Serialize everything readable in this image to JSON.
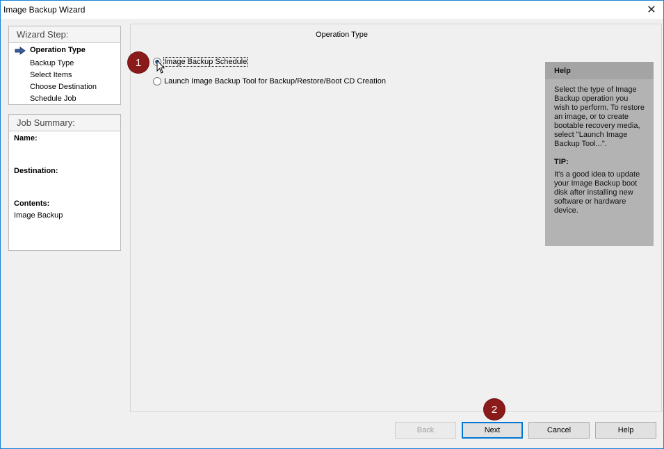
{
  "window": {
    "title": "Image Backup Wizard"
  },
  "wizard_steps": {
    "header": "Wizard Step:",
    "items": [
      {
        "label": "Operation Type",
        "active": true
      },
      {
        "label": "Backup Type",
        "active": false
      },
      {
        "label": "Select Items",
        "active": false
      },
      {
        "label": "Choose Destination",
        "active": false
      },
      {
        "label": "Schedule Job",
        "active": false
      }
    ]
  },
  "job_summary": {
    "header": "Job Summary:",
    "name_label": "Name:",
    "name_value": "",
    "destination_label": "Destination:",
    "destination_value": "",
    "contents_label": "Contents:",
    "contents_value": "Image Backup"
  },
  "main": {
    "title": "Operation Type",
    "options": [
      {
        "label": "Image Backup Schedule",
        "selected": true
      },
      {
        "label": "Launch Image Backup Tool for Backup/Restore/Boot CD Creation",
        "selected": false
      }
    ]
  },
  "help": {
    "header": "Help",
    "text": "Select the type of Image Backup operation you wish to perform.  To restore an image, or to create bootable recovery media, select \"Launch Image Backup Tool...\".",
    "tip_label": "TIP:",
    "tip_text": "It's a good idea to update your Image Backup boot disk after installing new software or hardware device."
  },
  "badges": {
    "first": "1",
    "second": "2"
  },
  "buttons": {
    "back": "Back",
    "next": "Next",
    "cancel": "Cancel",
    "help": "Help"
  },
  "colors": {
    "badge": "#8b1a1a",
    "accent": "#0078d7",
    "help_bg": "#b3b3b3"
  }
}
